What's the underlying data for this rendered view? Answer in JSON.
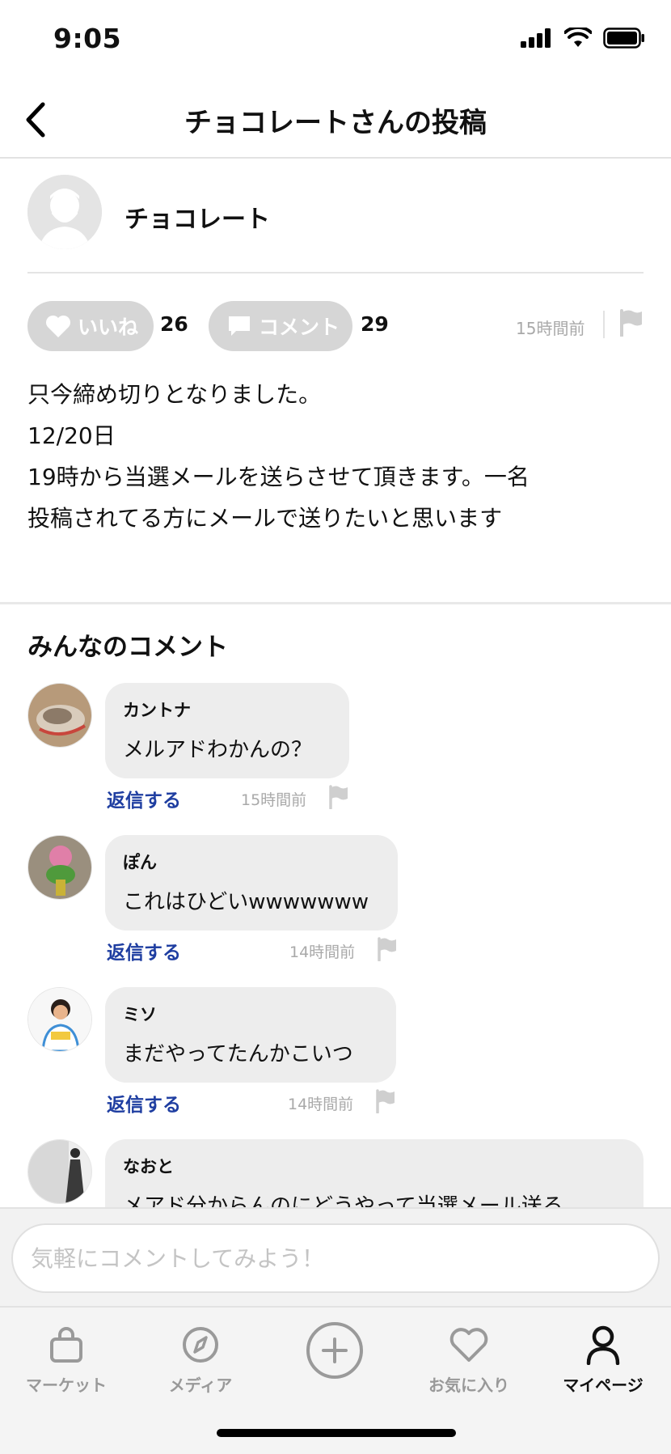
{
  "status_bar": {
    "time": "9:05"
  },
  "nav": {
    "title": "チョコレートさんの投稿"
  },
  "post": {
    "author": "チョコレート",
    "like_label": "いいね",
    "like_count": "26",
    "comment_label": "コメント",
    "comment_count": "29",
    "time": "15時間前",
    "body_lines": [
      "只今締め切りとなりました。",
      "12/20日",
      "19時から当選メールを送らさせて頂きます。一名",
      "投稿されてる方にメールで送りたいと思います"
    ]
  },
  "comments_section": {
    "title": "みんなのコメント",
    "reply_label": "返信する",
    "items": [
      {
        "name": "カントナ",
        "text": "メルアドわかんの？",
        "time": "15時間前"
      },
      {
        "name": "ぽん",
        "text": "これはひどいwwwwwww",
        "time": "14時間前"
      },
      {
        "name": "ミソ",
        "text": "まだやってたんかこいつ",
        "time": "14時間前"
      },
      {
        "name": "なおと",
        "text": "メアド分からんのにどうやって当選メール送る",
        "time": ""
      }
    ]
  },
  "comment_input": {
    "placeholder": "気軽にコメントしてみよう！"
  },
  "tab_bar": {
    "items": [
      {
        "label": "マーケット",
        "icon": "bag-icon"
      },
      {
        "label": "メディア",
        "icon": "compass-icon"
      },
      {
        "label": "",
        "icon": "plus-circle-icon"
      },
      {
        "label": "お気に入り",
        "icon": "heart-icon"
      },
      {
        "label": "マイページ",
        "icon": "person-icon",
        "active": true
      }
    ]
  },
  "colors": {
    "accent_blue": "#1f3ea1",
    "pill_gray": "#d6d6d6",
    "muted": "#a9a9a9"
  }
}
